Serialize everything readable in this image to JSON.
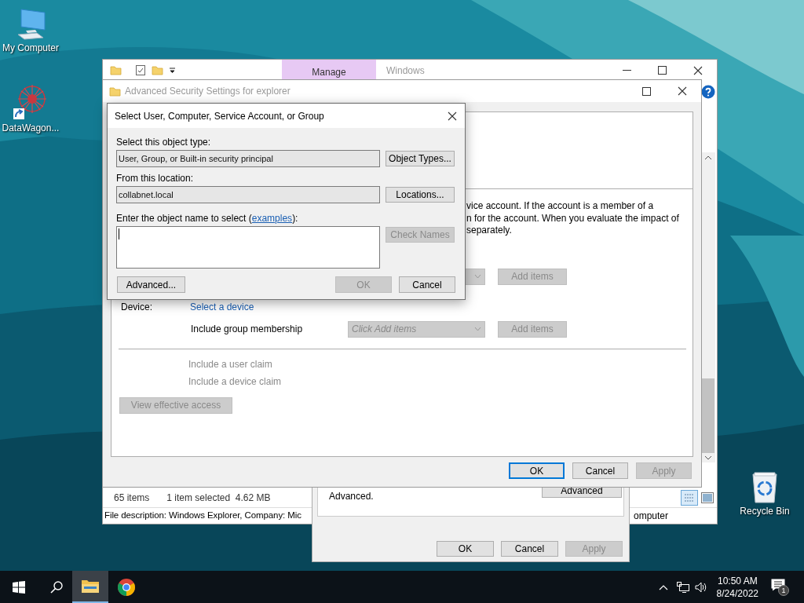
{
  "desktop_icons": [
    {
      "label": "My Computer",
      "kind": "computer"
    },
    {
      "label": "DataWagon...",
      "kind": "app"
    },
    {
      "label": "Recycle Bin",
      "kind": "recycle"
    }
  ],
  "explorer": {
    "title": "Windows",
    "contextual_tab": "Manage",
    "status_items": "65 items",
    "status_selection": "1 item selected  4.62 MB",
    "details": "File description: Windows Explorer, Company: Mic",
    "details_right": "omputer"
  },
  "properties": {
    "text": "Advanced.",
    "advanced_button": "Advanced",
    "buttons": [
      {
        "label": "OK",
        "disabled": false
      },
      {
        "label": "Cancel",
        "disabled": false
      },
      {
        "label": "Apply",
        "disabled": true
      }
    ]
  },
  "security": {
    "title": "Advanced Security Settings for explorer",
    "description_lines": [
      "vice account. If the account is a member of a",
      "n for the account. When you evaluate the impact of",
      "separately."
    ],
    "user_button": {
      "label": "Add items",
      "disabled": true
    },
    "device_label": "Device:",
    "device_link": "Select a device",
    "group_label": "Include group membership",
    "group_dropdown": {
      "placeholder": "Click Add items",
      "disabled": true
    },
    "group_button": {
      "label": "Add items",
      "disabled": true
    },
    "claims": [
      {
        "label": "Include a user claim",
        "disabled": true
      },
      {
        "label": "Include a device claim",
        "disabled": true
      }
    ],
    "view_button": {
      "label": "View effective access",
      "disabled": true
    },
    "buttons": [
      {
        "label": "OK",
        "disabled": false,
        "default": true
      },
      {
        "label": "Cancel",
        "disabled": false,
        "default": false
      },
      {
        "label": "Apply",
        "disabled": true,
        "default": false
      }
    ]
  },
  "dialog": {
    "title": "Select User, Computer, Service Account, or Group",
    "fields": [
      {
        "label": "Select this object type:",
        "value": "User, Group, or Built-in security principal",
        "button": "Object Types..."
      },
      {
        "label": "From this location:",
        "value": "collabnet.local",
        "button": "Locations..."
      }
    ],
    "name_label": {
      "before": "Enter the object name to select (",
      "link": "examples",
      "after": "):"
    },
    "check_names": {
      "label": "Check Names",
      "disabled": true
    },
    "advanced_button": "Advanced...",
    "buttons": [
      {
        "label": "OK",
        "disabled": true
      },
      {
        "label": "Cancel",
        "disabled": false
      }
    ]
  },
  "taskbar": {
    "apps": [
      {
        "kind": "explorer",
        "active": true
      },
      {
        "kind": "chrome",
        "active": false
      }
    ],
    "time": "10:50 AM",
    "date": "8/24/2022",
    "notification_count": "1"
  }
}
